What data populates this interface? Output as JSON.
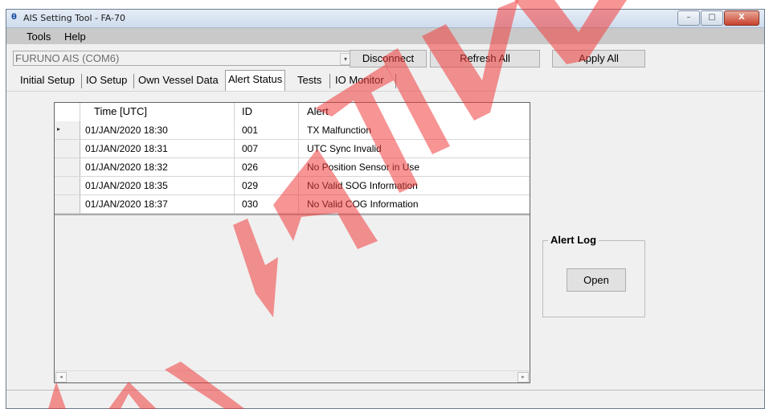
{
  "window": {
    "title": "AIS Setting Tool - FA-70",
    "icon_glyph": "θ",
    "buttons": {
      "minimize": "–",
      "maximize": "□",
      "close": "X"
    }
  },
  "menu": {
    "items": [
      "Tools",
      "Help"
    ]
  },
  "toolbar": {
    "device_select": "FURUNO AIS (COM6)",
    "dropdown_arrow": "▾",
    "disconnect_label": "Disconnect",
    "refresh_label": "Refresh All",
    "apply_label": "Apply All"
  },
  "tabs": [
    "Initial Setup",
    "IO Setup",
    "Own Vessel Data",
    "Alert Status",
    "Tests",
    "IO Monitor"
  ],
  "active_tab": "Alert Status",
  "grid": {
    "columns": [
      "Time [UTC]",
      "ID",
      "Alert"
    ],
    "current_row_marker": "▸",
    "rows": [
      {
        "time": "01/JAN/2020 18:30",
        "id": "001",
        "alert": "TX Malfunction"
      },
      {
        "time": "01/JAN/2020 18:31",
        "id": "007",
        "alert": "UTC Sync Invalid"
      },
      {
        "time": "01/JAN/2020 18:32",
        "id": "026",
        "alert": "No Position Sensor in Use"
      },
      {
        "time": "01/JAN/2020 18:35",
        "id": "029",
        "alert": "No Valid SOG Information"
      },
      {
        "time": "01/JAN/2020 18:37",
        "id": "030",
        "alert": "No Valid COG Information"
      }
    ],
    "scroll_left": "◂",
    "scroll_right": "▸"
  },
  "alert_log": {
    "label": "Alert Log",
    "open_label": "Open"
  },
  "watermark": {
    "color": "#f03c3c"
  }
}
